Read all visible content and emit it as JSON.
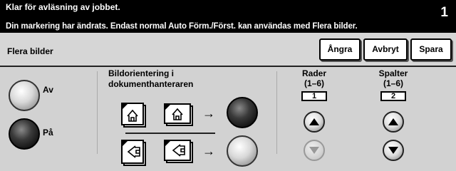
{
  "status": {
    "line1": "Klar för avläsning av jobbet.",
    "line2": "Din markering har ändrats. Endast normal Auto Förm./Först. kan användas med Flera bilder.",
    "job_count": "1"
  },
  "header": {
    "title": "Flera bilder",
    "undo_label": "Ångra",
    "cancel_label": "Avbryt",
    "save_label": "Spara"
  },
  "mode": {
    "off_label": "Av",
    "on_label": "På",
    "selected": "På"
  },
  "orientation": {
    "title_line1": "Bildorientering i",
    "title_line2": "dokumenthanteraren",
    "arrow": "→",
    "options": [
      {
        "name": "upright",
        "selected": true
      },
      {
        "name": "sideways",
        "selected": false
      }
    ]
  },
  "rows": {
    "label_line1": "Rader",
    "label_line2": "(1–6)",
    "value": "1",
    "up_enabled": true,
    "down_enabled": false
  },
  "columns": {
    "label_line1": "Spalter",
    "label_line2": "(1–6)",
    "value": "2",
    "up_enabled": true,
    "down_enabled": true
  },
  "icons": {
    "doc_upright": "document-upright-icon",
    "doc_rotated": "document-rotated-icon",
    "up": "triangle-up-icon",
    "down": "triangle-down-icon"
  }
}
